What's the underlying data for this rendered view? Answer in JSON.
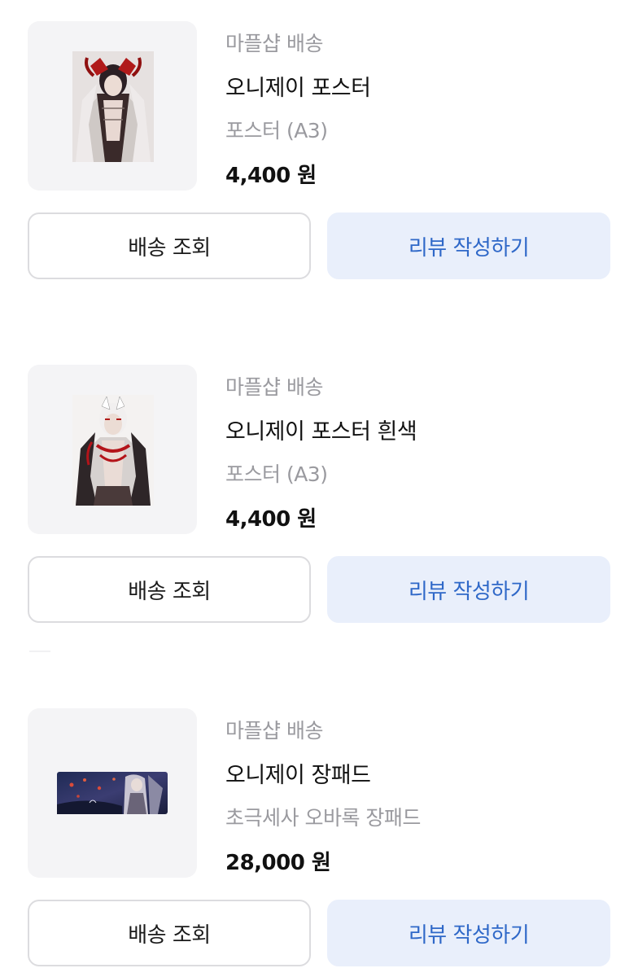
{
  "orders": [
    {
      "shop": "마플샵 배송",
      "product_name": "오니제이 포스터",
      "option": "포스터 (A3)",
      "price": "4,400 원",
      "track_button": "배송 조회",
      "review_button": "리뷰 작성하기",
      "thumbnail_icon": "poster-image"
    },
    {
      "shop": "마플샵 배송",
      "product_name": "오니제이 포스터 흰색",
      "option": "포스터 (A3)",
      "price": "4,400 원",
      "track_button": "배송 조회",
      "review_button": "리뷰 작성하기",
      "thumbnail_icon": "poster-image"
    },
    {
      "shop": "마플샵 배송",
      "product_name": "오니제이 장패드",
      "option": "초극세사 오바록 장패드",
      "price": "28,000 원",
      "track_button": "배송 조회",
      "review_button": "리뷰 작성하기",
      "thumbnail_icon": "desk-mat-image"
    }
  ],
  "colors": {
    "muted_text": "#9a9a9f",
    "review_bg": "#e9effb",
    "review_text": "#2f68c8",
    "border": "#dcdcdf"
  }
}
